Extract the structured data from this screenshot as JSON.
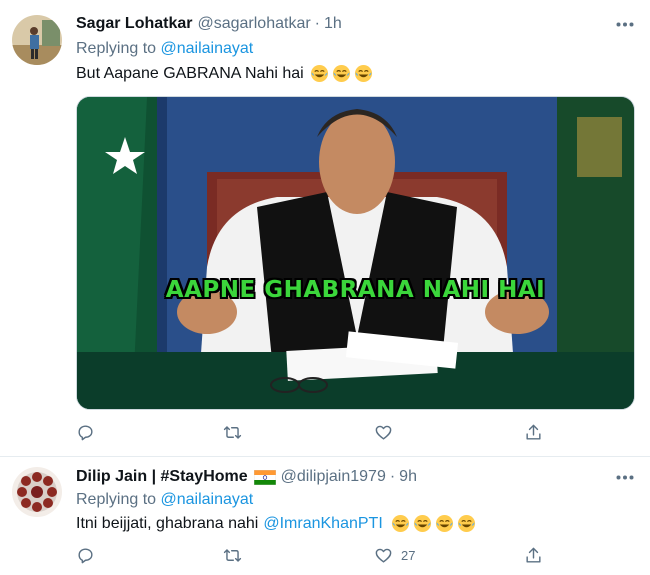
{
  "tweets": [
    {
      "name": "Sagar Lohatkar",
      "handle": "@sagarlohatkar",
      "dot": "·",
      "time": "1h",
      "replying_prefix": "Replying to",
      "replying_to": "@nailainayat",
      "text": "But Aapane GABRANA Nahi hai",
      "emoji_count": 3,
      "media_caption": "AAPNE GHABRANA NAHI HAI",
      "likes": ""
    },
    {
      "name": "Dilip Jain | #StayHome",
      "handle": "@dilipjain1979",
      "dot": "·",
      "time": "9h",
      "replying_prefix": "Replying to",
      "replying_to": "@nailainayat",
      "text": "Itni beijjati, ghabrana nahi",
      "text_mention": "@ImranKhanPTI",
      "emoji_count": 4,
      "likes": "27"
    }
  ],
  "icons": {
    "reply": "reply-icon",
    "retweet": "retweet-icon",
    "like": "like-icon",
    "share": "share-icon",
    "more": "more-icon",
    "emoji": "tears-of-joy-emoji"
  },
  "colors": {
    "link": "#1b95e0",
    "secondary": "#5b7083",
    "caption": "#3bd63b"
  }
}
